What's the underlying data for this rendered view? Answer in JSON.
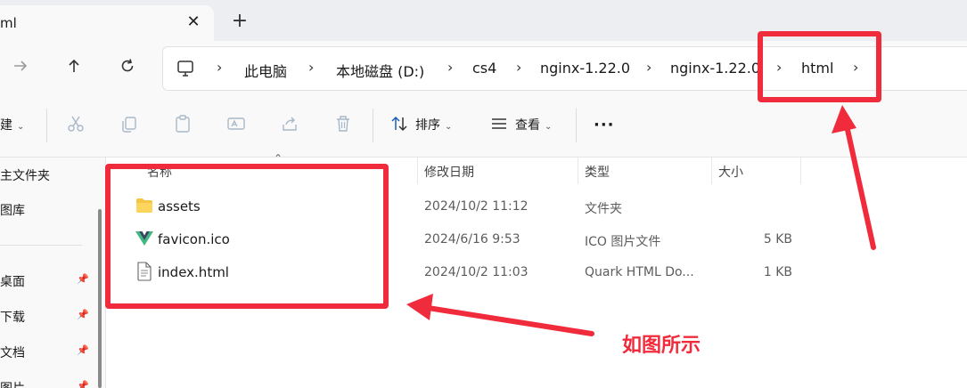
{
  "tab": {
    "title": "ml",
    "close_glyph": "✕",
    "new_tab_glyph": "+"
  },
  "nav": {
    "forward_icon": "arrow-right-icon",
    "up_icon": "arrow-up-icon",
    "refresh_icon": "refresh-icon",
    "breadcrumbs": [
      "此电脑",
      "本地磁盘 (D:)",
      "cs4",
      "nginx-1.22.0",
      "nginx-1.22.0",
      "html"
    ]
  },
  "toolbar": {
    "new_label": "建",
    "sort_label": "排序",
    "view_label": "查看",
    "more_label": "···"
  },
  "sidebar": {
    "items": [
      {
        "label": "主文件夹",
        "pinned": false
      },
      {
        "label": "图库",
        "pinned": false
      },
      {
        "label": "桌面",
        "pinned": true
      },
      {
        "label": "下载",
        "pinned": true
      },
      {
        "label": "文档",
        "pinned": true
      },
      {
        "label": "图片",
        "pinned": true
      }
    ]
  },
  "table": {
    "headers": {
      "name": "名称",
      "modified": "修改日期",
      "type": "类型",
      "size": "大小"
    },
    "rows": [
      {
        "name": "assets",
        "modified": "2024/10/2 11:12",
        "type": "文件夹",
        "size": "",
        "icon": "folder-icon"
      },
      {
        "name": "favicon.ico",
        "modified": "2024/6/16 9:53",
        "type": "ICO 图片文件",
        "size": "5 KB",
        "icon": "vue-logo-icon"
      },
      {
        "name": "index.html",
        "modified": "2024/10/2 11:03",
        "type": "Quark HTML Do...",
        "size": "1 KB",
        "icon": "document-icon"
      }
    ]
  },
  "annotation": {
    "text": "如图所示",
    "color": "#f02b3c"
  }
}
